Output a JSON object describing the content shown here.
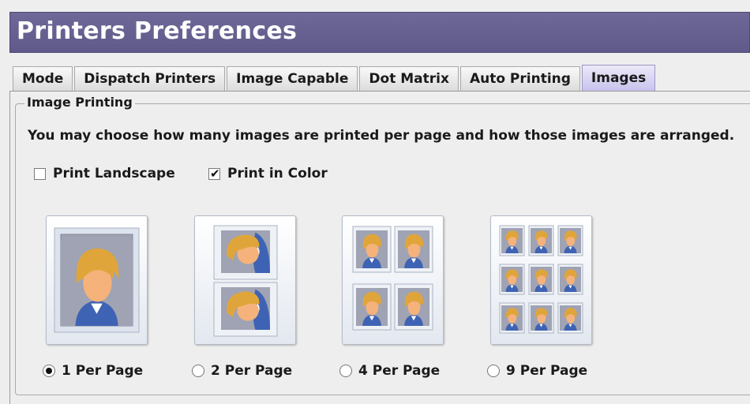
{
  "window": {
    "title": "Printers Preferences"
  },
  "tabs": [
    {
      "label": "Mode",
      "active": false
    },
    {
      "label": "Dispatch Printers",
      "active": false
    },
    {
      "label": "Image Capable",
      "active": false
    },
    {
      "label": "Dot Matrix",
      "active": false
    },
    {
      "label": "Auto Printing",
      "active": false
    },
    {
      "label": "Images",
      "active": true
    }
  ],
  "image_printing": {
    "group_title": "Image Printing",
    "description": "You may choose how many images are printed per page and how those images are arranged.",
    "print_landscape": {
      "label": "Print Landscape",
      "checked": false
    },
    "print_in_color": {
      "label": "Print in Color",
      "checked": true
    },
    "layouts": [
      {
        "label": "1 Per Page",
        "selected": true
      },
      {
        "label": "2 Per Page",
        "selected": false
      },
      {
        "label": "4 Per Page",
        "selected": false
      },
      {
        "label": "9 Per Page",
        "selected": false
      }
    ]
  },
  "colors": {
    "title_bar": "#5f5a8a",
    "active_tab": "#c8c3ec",
    "portrait_bg": "#9fa3b3",
    "hair": "#e0a53a",
    "skin": "#f5b27a",
    "shirt": "#3f63b4"
  }
}
